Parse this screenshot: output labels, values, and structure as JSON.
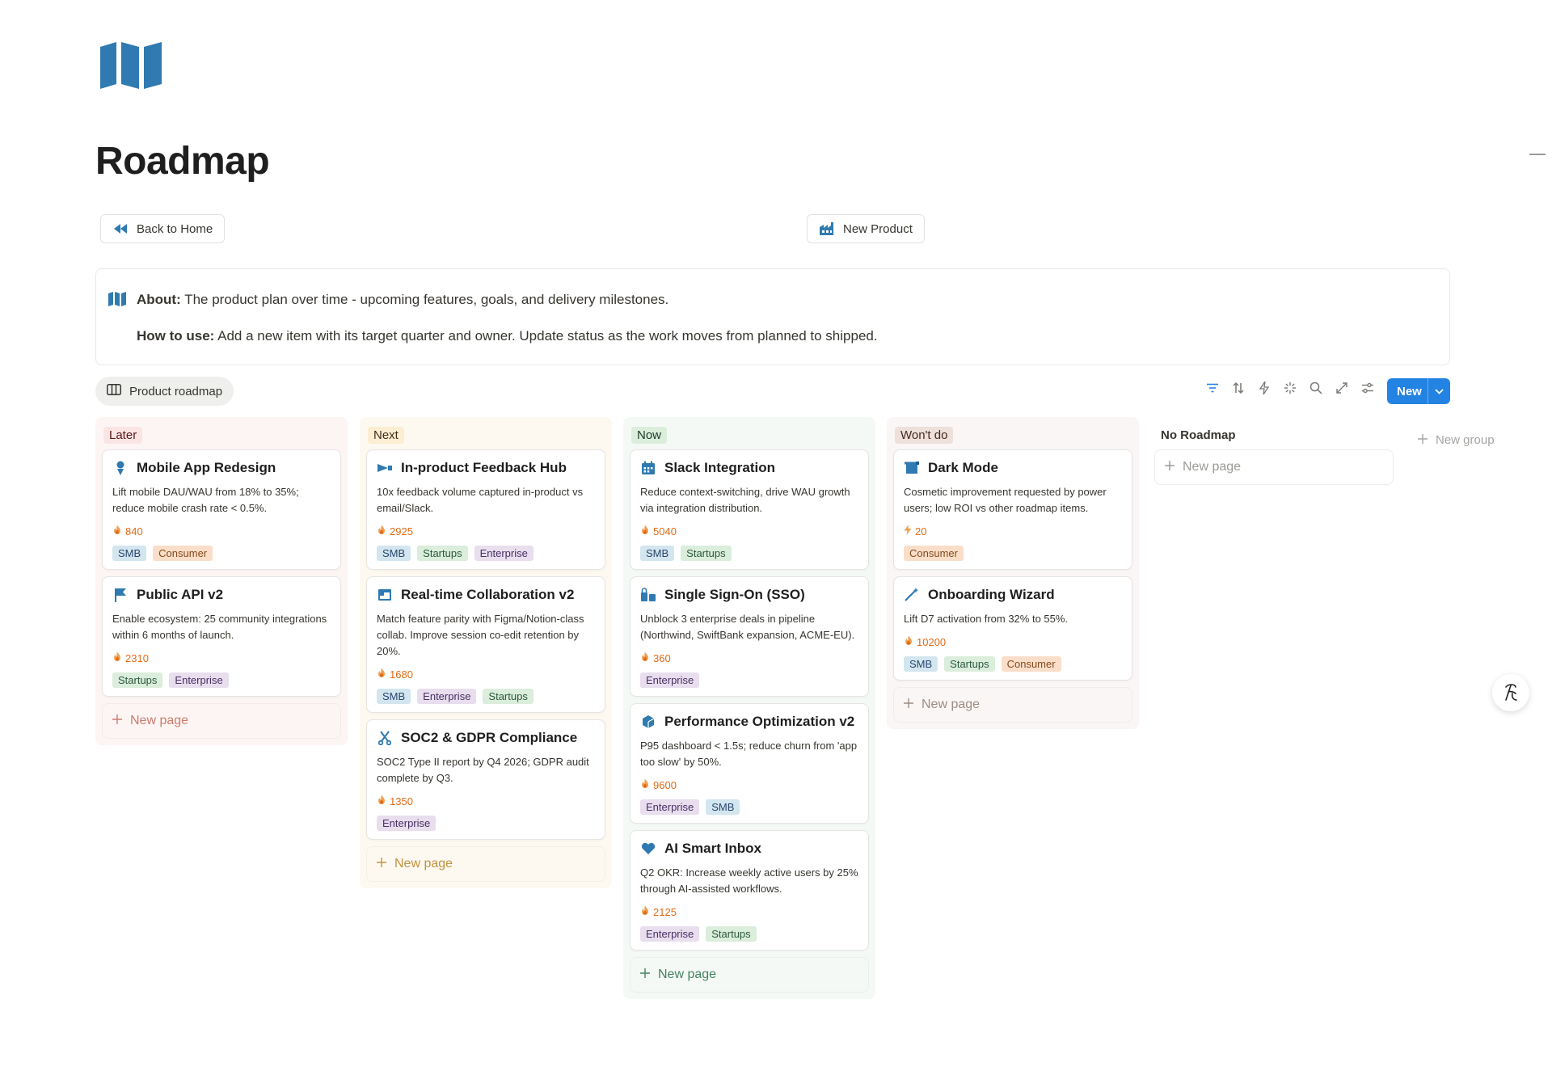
{
  "page": {
    "title": "Roadmap",
    "icon": "map-icon"
  },
  "buttons": {
    "back_home": "Back to Home",
    "new_product": "New Product"
  },
  "callout": {
    "icon": "map-icon",
    "about_label": "About:",
    "about_text": "The product plan over time - upcoming features, goals, and delivery milestones.",
    "howto_label": "How to use:",
    "howto_text": "Add a new item with its target quarter and owner. Update status as the work moves from planned to shipped."
  },
  "view": {
    "tab_label": "Product roadmap",
    "new_label": "New",
    "toolbar_icons": [
      "filter-icon",
      "sort-icon",
      "automation-icon",
      "sparkle-icon",
      "search-icon",
      "expand-icon",
      "settings-icon"
    ]
  },
  "colors": {
    "accent": "#2383e2",
    "later_bg": "#fdf5f4",
    "later_badge": "#fbe4e4",
    "next_bg": "#fdf9f0",
    "next_badge": "#fbeed2",
    "now_bg": "#f5f9f6",
    "now_badge": "#dbeddb",
    "wontdo_bg": "#f9f6f5",
    "wontdo_badge": "#eee0da",
    "score": "#e16b16"
  },
  "columns": [
    {
      "name": "Later",
      "new_page": "New page",
      "cards": [
        {
          "icon": "person-icon",
          "title": "Mobile App Redesign",
          "desc": "Lift mobile DAU/WAU from 18% to 35%; reduce mobile crash rate < 0.5%.",
          "score": "840",
          "score_icon": "fire-icon",
          "tags": [
            "SMB",
            "Consumer"
          ]
        },
        {
          "icon": "flag-icon",
          "title": "Public API v2",
          "desc": "Enable ecosystem: 25 community integrations within 6 months of launch.",
          "score": "2310",
          "score_icon": "fire-icon",
          "tags": [
            "Startups",
            "Enterprise"
          ]
        }
      ]
    },
    {
      "name": "Next",
      "new_page": "New page",
      "cards": [
        {
          "icon": "megaphone-icon",
          "title": "In-product Feedback Hub",
          "desc": "10x feedback volume captured in-product vs email/Slack.",
          "score": "2925",
          "score_icon": "fire-icon",
          "tags": [
            "SMB",
            "Startups",
            "Enterprise"
          ]
        },
        {
          "icon": "window-icon",
          "title": "Real-time Collaboration v2",
          "desc": "Match feature parity with Figma/Notion-class collab. Improve session co-edit retention by 20%.",
          "score": "1680",
          "score_icon": "fire-icon",
          "tags": [
            "SMB",
            "Enterprise",
            "Startups"
          ]
        },
        {
          "icon": "scissors-icon",
          "title": "SOC2 & GDPR Compliance",
          "desc": "SOC2 Type II report by Q4 2026; GDPR audit complete by Q3.",
          "score": "1350",
          "score_icon": "fire-icon",
          "tags": [
            "Enterprise"
          ]
        }
      ]
    },
    {
      "name": "Now",
      "new_page": "New page",
      "cards": [
        {
          "icon": "calendar-icon",
          "title": "Slack Integration",
          "desc": "Reduce context-switching, drive WAU growth via integration distribution.",
          "score": "5040",
          "score_icon": "fire-icon",
          "tags": [
            "SMB",
            "Startups"
          ]
        },
        {
          "icon": "lock-icon",
          "title": "Single Sign-On (SSO)",
          "desc": "Unblock 3 enterprise deals in pipeline (Northwind, SwiftBank expansion, ACME-EU).",
          "score": "360",
          "score_icon": "fire-icon",
          "tags": [
            "Enterprise"
          ]
        },
        {
          "icon": "cube-icon",
          "title": "Performance Optimization v2",
          "desc": "P95 dashboard < 1.5s; reduce churn from 'app too slow' by 50%.",
          "score": "9600",
          "score_icon": "fire-icon",
          "tags": [
            "Enterprise",
            "SMB"
          ]
        },
        {
          "icon": "heart-icon",
          "title": "AI Smart Inbox",
          "desc": "Q2 OKR: Increase weekly active users by 25% through AI-assisted workflows.",
          "score": "2125",
          "score_icon": "fire-icon",
          "tags": [
            "Enterprise",
            "Startups"
          ]
        }
      ]
    },
    {
      "name": "Won't do",
      "new_page": "New page",
      "cards": [
        {
          "icon": "moon-icon",
          "title": "Dark Mode",
          "desc": "Cosmetic improvement requested by power users; low ROI vs other roadmap items.",
          "score": "20",
          "score_icon": "bolt-icon",
          "tags": [
            "Consumer"
          ]
        },
        {
          "icon": "wand-icon",
          "title": "Onboarding Wizard",
          "desc": "Lift D7 activation from 32% to 55%.",
          "score": "10200",
          "score_icon": "fire-icon",
          "tags": [
            "SMB",
            "Startups",
            "Consumer"
          ]
        }
      ]
    },
    {
      "name": "No Roadmap",
      "new_page": "New page",
      "cards": []
    }
  ],
  "new_group": "New group"
}
